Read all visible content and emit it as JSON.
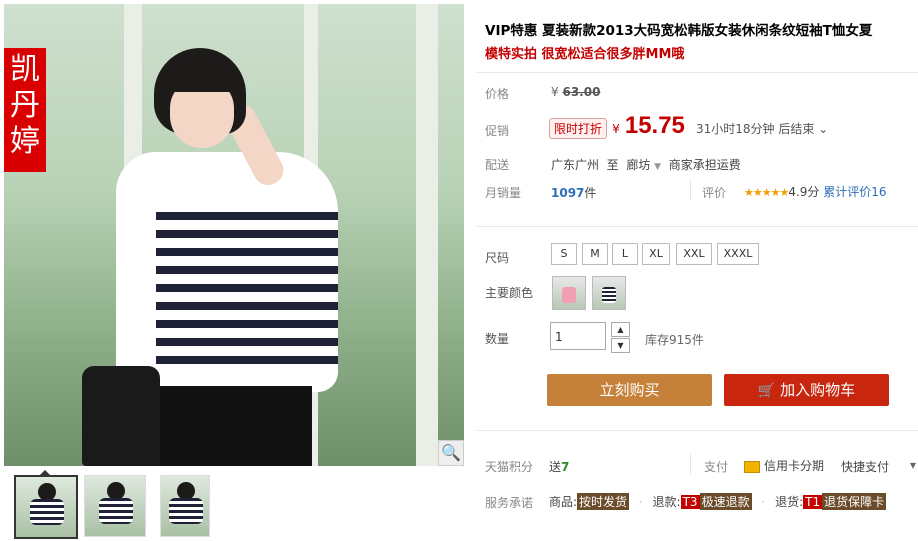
{
  "product": {
    "title": "VIP特惠 夏装新款2013大码宽松韩版女装休闲条纹短袖T恤女夏",
    "subtitle": "模特实拍 很宽松适合很多胖MM哦",
    "brand_badge": "凯丹婷"
  },
  "price": {
    "label": "价格",
    "currency": "¥",
    "original": "63.00"
  },
  "promo": {
    "label": "促销",
    "badge": "限时打折",
    "currency": "¥",
    "price": "15.75",
    "countdown": "31小时18分钟 后结束",
    "countdown_chevron": "⌄"
  },
  "shipping": {
    "label": "配送",
    "from": "广东广州",
    "to_word": "至",
    "to": "廊坊",
    "fee": "商家承担运费"
  },
  "sales": {
    "label": "月销量",
    "count": "1097",
    "unit": "件",
    "rating_label": "评价",
    "stars": "★★★★★",
    "score": "4.9分",
    "reviews": "累计评价16"
  },
  "options": {
    "size_label": "尺码",
    "sizes": [
      "S",
      "M",
      "L",
      "XL",
      "XXL",
      "XXXL"
    ],
    "color_label": "主要颜色",
    "qty_label": "数量",
    "qty_value": "1",
    "stock": "库存915件"
  },
  "actions": {
    "buy": "立刻购买",
    "cart": "加入购物车"
  },
  "points": {
    "label": "天猫积分",
    "give": "送",
    "value": "7",
    "pay_label": "支付",
    "credit": "信用卡分期",
    "fast_pay": "快捷支付",
    "fast_pay_chevron": "▾"
  },
  "service": {
    "label": "服务承诺",
    "goods_prefix": "商品:",
    "goods_tag": "按时发货",
    "refund_prefix": "退款:",
    "refund_code": "T3",
    "refund_tag": "极速退款",
    "return_prefix": "退货:",
    "return_code": "T1",
    "return_tag": "退货保障卡",
    "sep": "·"
  },
  "icons": {
    "zoom": "magnifier-icon",
    "cart": "cart-icon",
    "card": "credit-card-icon"
  },
  "colors": {
    "price_red": "#c40000",
    "buy_orange": "#c5813a",
    "cart_red": "#c9260f",
    "link_blue": "#2d6eb8"
  }
}
